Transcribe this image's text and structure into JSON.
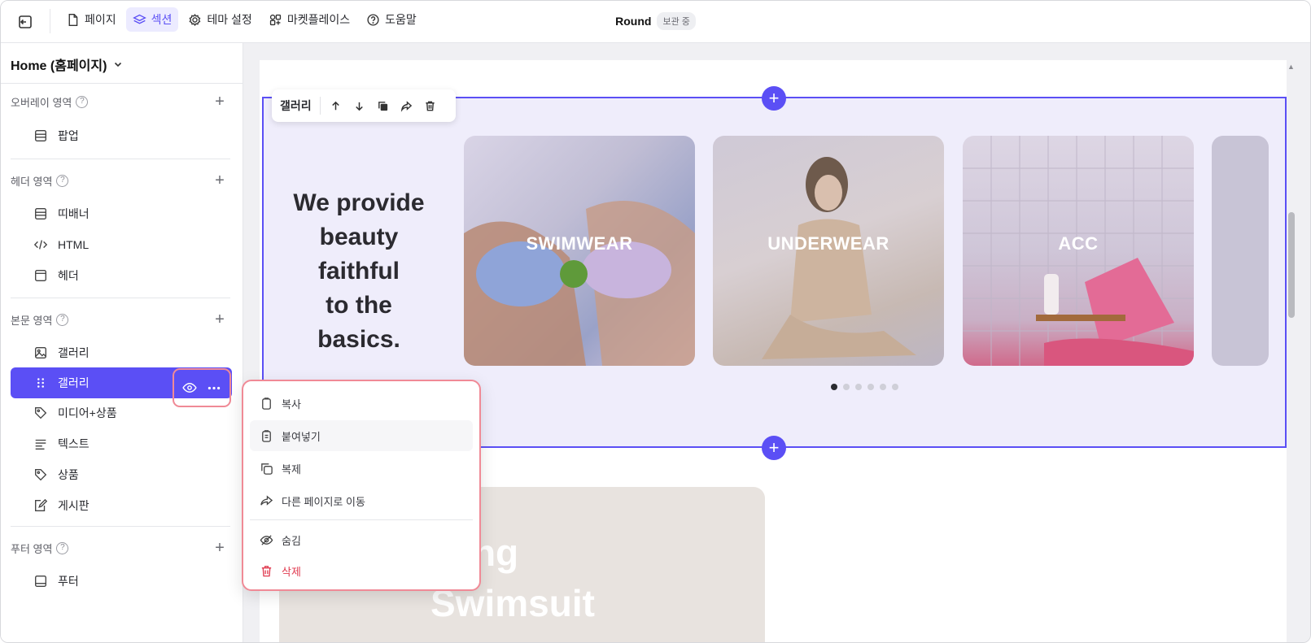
{
  "topbar": {
    "nav": [
      {
        "label": "페이지",
        "icon": "file-icon"
      },
      {
        "label": "섹션",
        "icon": "layers-icon",
        "active": true
      },
      {
        "label": "테마 설정",
        "icon": "gear-icon"
      },
      {
        "label": "마켓플레이스",
        "icon": "apps-icon"
      },
      {
        "label": "도움말",
        "icon": "help-circle-icon"
      }
    ],
    "doc_title": "Round",
    "save_status": "보관 중"
  },
  "sidebar": {
    "page_select": "Home (홈페이지)",
    "groups": [
      {
        "title": "오버레이 영역",
        "items": [
          {
            "label": "팝업",
            "icon": "panel-icon"
          }
        ]
      },
      {
        "title": "헤더 영역",
        "items": [
          {
            "label": "띠배너",
            "icon": "panel-icon"
          },
          {
            "label": "HTML",
            "icon": "code-icon"
          },
          {
            "label": "헤더",
            "icon": "header-icon"
          }
        ]
      },
      {
        "title": "본문 영역",
        "items": [
          {
            "label": "갤러리",
            "icon": "image-icon"
          },
          {
            "label": "갤러리",
            "icon": "drag-icon",
            "selected": true
          },
          {
            "label": "미디어+상품",
            "icon": "tag-icon"
          },
          {
            "label": "텍스트",
            "icon": "text-icon"
          },
          {
            "label": "상품",
            "icon": "tag-icon"
          },
          {
            "label": "게시판",
            "icon": "edit-icon"
          }
        ]
      },
      {
        "title": "푸터 영역",
        "items": [
          {
            "label": "푸터",
            "icon": "footer-icon"
          }
        ]
      }
    ]
  },
  "toolbar": {
    "label": "갤러리"
  },
  "section": {
    "hero_text": [
      "We provide",
      "beauty",
      "faithful",
      "to the",
      "basics."
    ],
    "cards": [
      "SWIMWEAR",
      "UNDERWEAR",
      "ACC"
    ],
    "dots_total": 6,
    "dots_active": 1
  },
  "second_section": {
    "title_lines": [
      "reshing",
      "Swimsuit"
    ]
  },
  "context_menu": {
    "items": [
      {
        "label": "복사",
        "icon": "clipboard-icon"
      },
      {
        "label": "붙여넣기",
        "icon": "paste-icon"
      },
      {
        "label": "복제",
        "icon": "duplicate-icon"
      },
      {
        "label": "다른 페이지로 이동",
        "icon": "share-icon"
      },
      {
        "label": "숨김",
        "icon": "eye-off-icon"
      },
      {
        "label": "삭제",
        "icon": "trash-icon",
        "danger": true
      }
    ]
  },
  "colors": {
    "accent": "#5b4ff5",
    "danger": "#e03a4f",
    "highlight": "#f08a96"
  }
}
